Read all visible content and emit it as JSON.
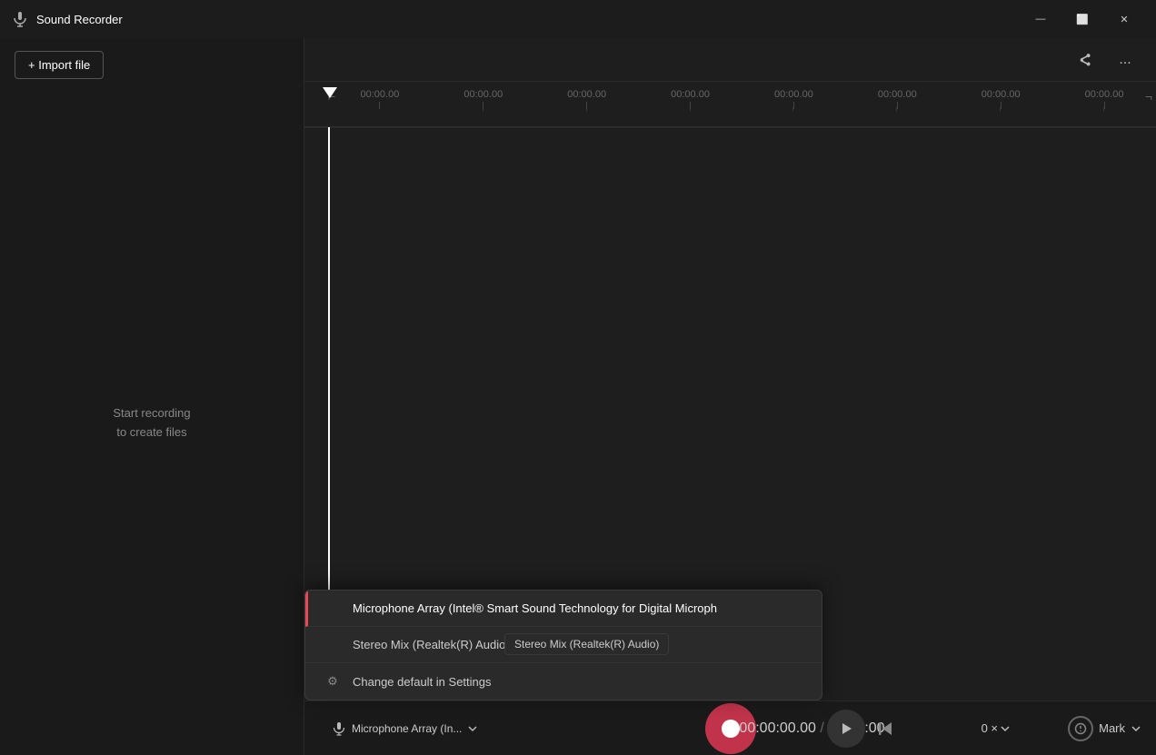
{
  "app": {
    "title": "Sound Recorder",
    "icon": "🎙️"
  },
  "titlebar": {
    "minimize_label": "—",
    "maximize_label": "⬜",
    "close_label": "✕"
  },
  "toolbar": {
    "import_label": "+ Import file",
    "share_icon": "share",
    "more_icon": "..."
  },
  "sidebar": {
    "empty_line1": "Start recording",
    "empty_line2": "to create files"
  },
  "timeline": {
    "marks": [
      "00:00.00",
      "00:00.00",
      "00:00.00",
      "00:00.00",
      "00:00.00",
      "00:00.00",
      "00:00.00",
      "00:00.00"
    ]
  },
  "bottom_bar": {
    "mic_label": "Microphone Array (In...",
    "current_time": "00:00:00.00",
    "total_time": "00:00:00",
    "speed": "0 ×",
    "mark_label": "Mark"
  },
  "dropdown": {
    "tooltip": "Stereo Mix (Realtek(R) Audio)",
    "items": [
      {
        "label": "Microphone Array (Intel® Smart Sound Technology for Digital Microph",
        "active": true,
        "icon": ""
      },
      {
        "label": "Stereo Mix (Realtek(R) Audio)",
        "active": false,
        "icon": ""
      },
      {
        "label": "Change default in Settings",
        "active": false,
        "icon": "⚙"
      }
    ]
  }
}
